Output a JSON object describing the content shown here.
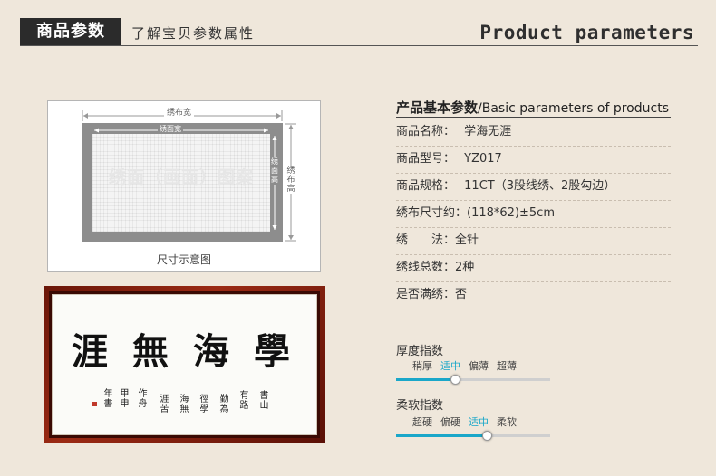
{
  "header": {
    "badge": "商品参数",
    "subtitle": "了解宝贝参数属性",
    "title_en": "Product parameters"
  },
  "diagram": {
    "cloth_width_label": "绣布宽",
    "canvas_width_label": "绣面宽",
    "canvas_height_label": "绣面高",
    "cloth_height_label": "绣布高",
    "watermark": "绣面（画面）图案",
    "caption": "尺寸示意图"
  },
  "artwork": {
    "main_chars": [
      "學",
      "海",
      "無",
      "涯"
    ],
    "inscription_cols": [
      "書山",
      "有路",
      "勤為",
      "徑學",
      "海無",
      "涯苦",
      "作舟",
      "甲申",
      "年書"
    ]
  },
  "params": {
    "title_zh": "产品基本参数",
    "title_en": "/Basic parameters of products",
    "rows": [
      {
        "label": "商品名称：",
        "value": "学海无涯"
      },
      {
        "label": "商品型号：",
        "value": "YZ017"
      },
      {
        "label": "商品规格：",
        "value": "11CT（3股线绣、2股勾边）"
      },
      {
        "label": "绣布尺寸约：",
        "value": "(118*62)±5cm"
      },
      {
        "label": "绣　　法：",
        "value": "全针"
      },
      {
        "label": "绣线总数：",
        "value": "2种"
      },
      {
        "label": "是否满绣：",
        "value": "否"
      }
    ]
  },
  "sliders": [
    {
      "title": "厚度指数",
      "options": [
        "稍厚",
        "适中",
        "偏薄",
        "超薄"
      ],
      "active_index": 1,
      "level_fraction": 0.38
    },
    {
      "title": "柔软指数",
      "options": [
        "超硬",
        "偏硬",
        "适中",
        "柔软"
      ],
      "active_index": 2,
      "level_fraction": 0.59
    }
  ],
  "colors": {
    "background": "#efe7db",
    "accent": "#1aa7c9",
    "frame": "#8a2210",
    "badge": "#2b2b2b"
  }
}
